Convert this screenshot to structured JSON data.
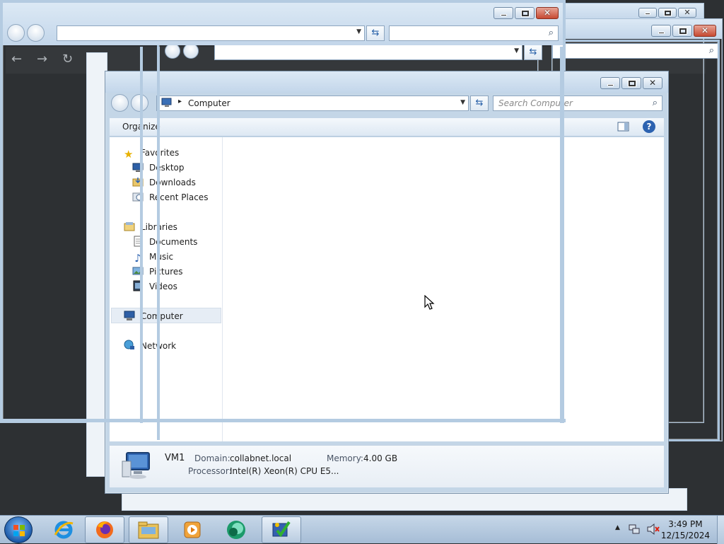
{
  "explorer": {
    "breadcrumb_arrow": "▸",
    "address": "Computer",
    "search_placeholder": "Search Computer",
    "toolbar_organize": "Organize",
    "nav": {
      "favorites": "Favorites",
      "desktop": "Desktop",
      "downloads": "Downloads",
      "recent_places": "Recent Places",
      "libraries": "Libraries",
      "documents": "Documents",
      "music": "Music",
      "pictures": "Pictures",
      "videos": "Videos",
      "computer": "Computer",
      "network": "Network"
    },
    "details": {
      "name": "VM1",
      "domain_label": "Domain:",
      "domain_value": "collabnet.local",
      "memory_label": "Memory:",
      "memory_value": "4.00 GB",
      "processor_label": "Processor:",
      "processor_value": "Intel(R) Xeon(R) CPU E5..."
    }
  },
  "taskbar": {
    "time": "3:49 PM",
    "date": "12/15/2024"
  },
  "colors": {
    "desktop_bg": "#2d3033",
    "frame": "#c4d6e7",
    "close_button": "#c74a32",
    "taskbar": "#b6cadf"
  }
}
